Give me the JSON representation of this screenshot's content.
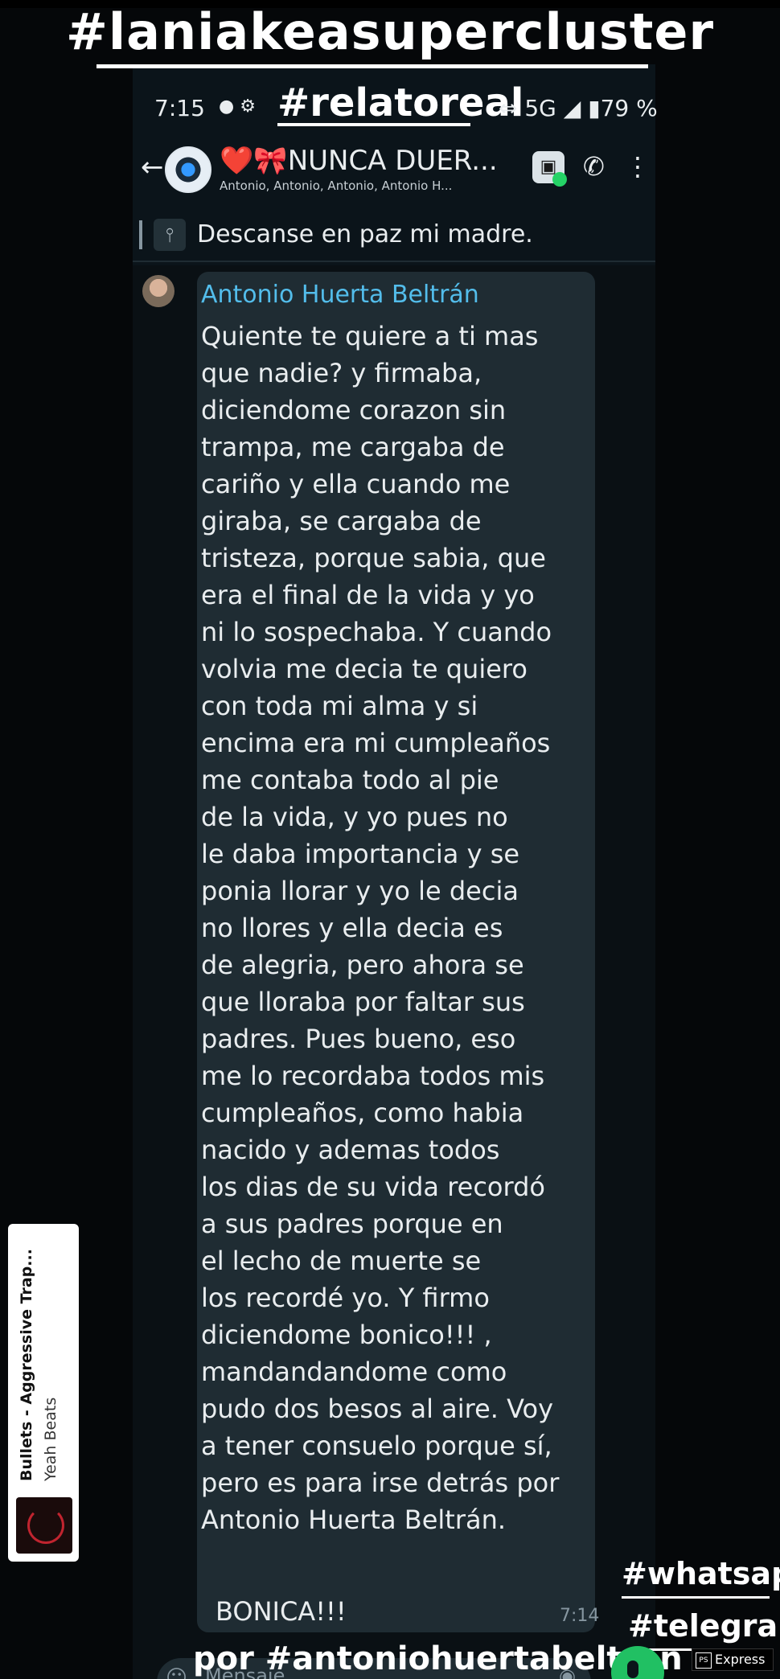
{
  "overlay": {
    "title": "#laniakeasupercluster",
    "tag_top": "#relatoreal",
    "tag_whatsapp": "#whatsapp",
    "tag_telegram": "#telegram",
    "tag_author": "por #antoniohuertabeltran"
  },
  "status_bar": {
    "time": "7:15",
    "left_icons": "● ⚙",
    "right": "⇔ 5G ◢ ▮79 %"
  },
  "header": {
    "group_name": "NUNCA DUER...",
    "group_prefix_heart": "❤️",
    "group_prefix_bow": "🎀",
    "members": "Antonio, Antonio, Antonio, Antonio H...",
    "icon_names": [
      "back-arrow-icon",
      "group-avatar",
      "video-call-icon",
      "add-call-icon",
      "more-options-icon"
    ]
  },
  "pinned": {
    "text": "Descanse en paz mi madre."
  },
  "message": {
    "sender": "Antonio Huerta Beltrán",
    "body": "Quiente te quiere a ti mas\nque nadie? y firmaba,\ndiciendome corazon sin\ntrampa, me cargaba de\ncariño y ella cuando me\ngiraba, se cargaba de\ntristeza, porque sabia, que\nera el final de la vida y yo\nni lo sospechaba. Y cuando\nvolvia me decia te quiero\ncon toda mi alma y si\nencima era mi cumpleaños\nme contaba todo al pie\nde la vida, y yo pues no\nle daba importancia y se\nponia llorar y yo le decia\nno llores y ella decia es\nde alegria, pero ahora se\nque lloraba por faltar sus\npadres. Pues bueno, eso\nme lo recordaba todos mis\ncumpleaños, como habia\nnacido y ademas todos\nlos dias de su vida recordó\na sus padres porque en\nel lecho de muerte se\nlos recordé yo. Y firmo\ndiciendome bonico!!! ,\nmandandandome como\npudo dos besos al aire. Voy\na tener consuelo porque sí,\npero es para irse detrás por\nAntonio Huerta Beltrán.",
    "signoff": "BONICA!!!",
    "time": "7:14"
  },
  "music": {
    "title": "Bullets - Aggressive Trap...",
    "artist": "Yeah Beats"
  },
  "input": {
    "placeholder": "Mensaje"
  },
  "watermark": {
    "box": "PS",
    "label": "Express"
  },
  "colors": {
    "chat_bg": "#0b141a",
    "bubble": "#1f2c33",
    "sender_name": "#53bdeb",
    "mic_button": "#21c063"
  }
}
